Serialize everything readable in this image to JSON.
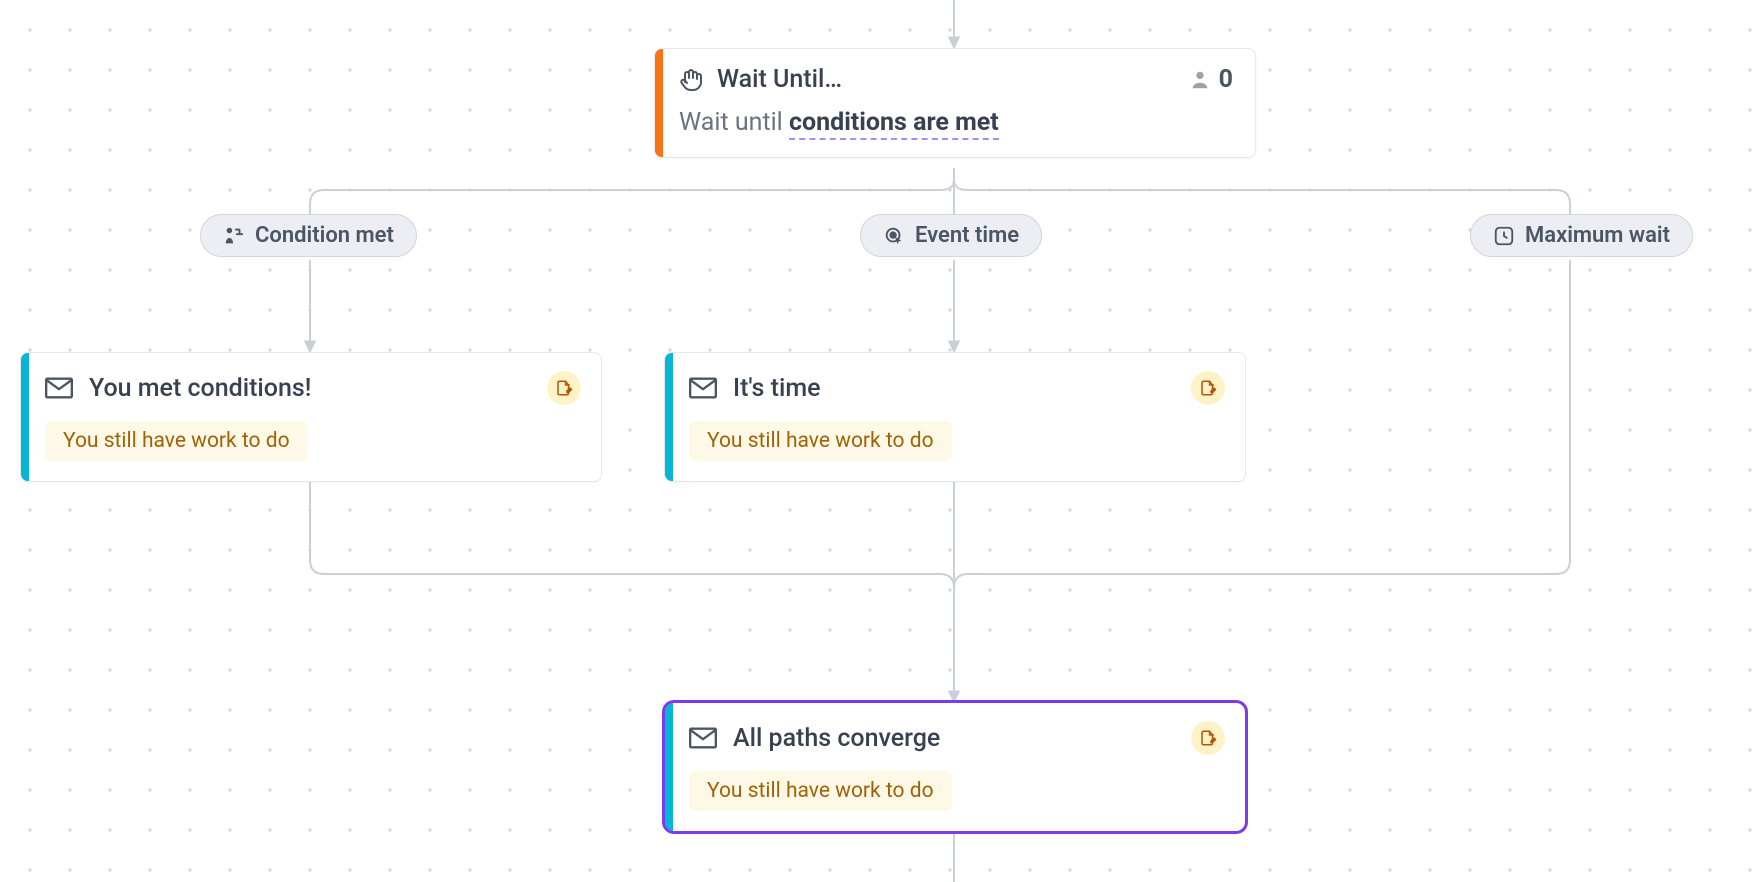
{
  "wait_node": {
    "title": "Wait Until…",
    "subtitle_prefix": "Wait until ",
    "subtitle_link": "conditions are met",
    "user_count": "0"
  },
  "branches": {
    "condition_met": {
      "label": "Condition met"
    },
    "event_time": {
      "label": "Event time"
    },
    "maximum_wait": {
      "label": "Maximum wait"
    }
  },
  "cards": {
    "conditions": {
      "title": "You met conditions!",
      "warning": "You still have work to do"
    },
    "its_time": {
      "title": "It's time",
      "warning": "You still have work to do"
    },
    "converge": {
      "title": "All paths converge",
      "warning": "You still have work to do"
    }
  },
  "colors": {
    "stripe_orange": "#f97316",
    "stripe_cyan": "#06b6d4",
    "selection_purple": "#7c3aed",
    "pill_bg": "#eceef3",
    "warn_bg": "#fef9e7",
    "warn_text": "#a16207"
  }
}
